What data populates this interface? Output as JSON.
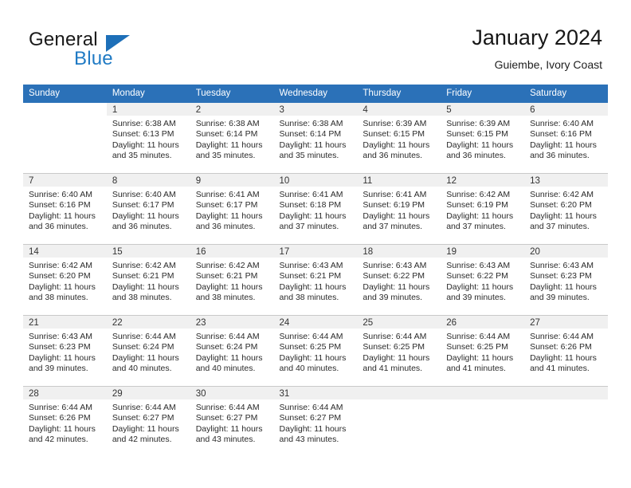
{
  "brand": {
    "name_part1": "General",
    "name_part2": "Blue",
    "flag_icon": "triangle-flag-icon"
  },
  "header": {
    "month_title": "January 2024",
    "location": "Guiembe, Ivory Coast"
  },
  "colors": {
    "header_blue": "#2b71b8",
    "brand_blue": "#1f7ac4",
    "daynum_strip": "#f0f0f0",
    "grid_line": "#c9c9c9"
  },
  "weekday_headers": [
    "Sunday",
    "Monday",
    "Tuesday",
    "Wednesday",
    "Thursday",
    "Friday",
    "Saturday"
  ],
  "labels": {
    "sunrise_prefix": "Sunrise:",
    "sunset_prefix": "Sunset:",
    "daylight_prefix": "Daylight:"
  },
  "weeks": [
    [
      {
        "day": "",
        "blank": true,
        "sunrise": "",
        "sunset": "",
        "daylight_line1": "",
        "daylight_line2": ""
      },
      {
        "day": "1",
        "sunrise": "Sunrise: 6:38 AM",
        "sunset": "Sunset: 6:13 PM",
        "daylight_line1": "Daylight: 11 hours",
        "daylight_line2": "and 35 minutes."
      },
      {
        "day": "2",
        "sunrise": "Sunrise: 6:38 AM",
        "sunset": "Sunset: 6:14 PM",
        "daylight_line1": "Daylight: 11 hours",
        "daylight_line2": "and 35 minutes."
      },
      {
        "day": "3",
        "sunrise": "Sunrise: 6:38 AM",
        "sunset": "Sunset: 6:14 PM",
        "daylight_line1": "Daylight: 11 hours",
        "daylight_line2": "and 35 minutes."
      },
      {
        "day": "4",
        "sunrise": "Sunrise: 6:39 AM",
        "sunset": "Sunset: 6:15 PM",
        "daylight_line1": "Daylight: 11 hours",
        "daylight_line2": "and 36 minutes."
      },
      {
        "day": "5",
        "sunrise": "Sunrise: 6:39 AM",
        "sunset": "Sunset: 6:15 PM",
        "daylight_line1": "Daylight: 11 hours",
        "daylight_line2": "and 36 minutes."
      },
      {
        "day": "6",
        "sunrise": "Sunrise: 6:40 AM",
        "sunset": "Sunset: 6:16 PM",
        "daylight_line1": "Daylight: 11 hours",
        "daylight_line2": "and 36 minutes."
      }
    ],
    [
      {
        "day": "7",
        "sunrise": "Sunrise: 6:40 AM",
        "sunset": "Sunset: 6:16 PM",
        "daylight_line1": "Daylight: 11 hours",
        "daylight_line2": "and 36 minutes."
      },
      {
        "day": "8",
        "sunrise": "Sunrise: 6:40 AM",
        "sunset": "Sunset: 6:17 PM",
        "daylight_line1": "Daylight: 11 hours",
        "daylight_line2": "and 36 minutes."
      },
      {
        "day": "9",
        "sunrise": "Sunrise: 6:41 AM",
        "sunset": "Sunset: 6:17 PM",
        "daylight_line1": "Daylight: 11 hours",
        "daylight_line2": "and 36 minutes."
      },
      {
        "day": "10",
        "sunrise": "Sunrise: 6:41 AM",
        "sunset": "Sunset: 6:18 PM",
        "daylight_line1": "Daylight: 11 hours",
        "daylight_line2": "and 37 minutes."
      },
      {
        "day": "11",
        "sunrise": "Sunrise: 6:41 AM",
        "sunset": "Sunset: 6:19 PM",
        "daylight_line1": "Daylight: 11 hours",
        "daylight_line2": "and 37 minutes."
      },
      {
        "day": "12",
        "sunrise": "Sunrise: 6:42 AM",
        "sunset": "Sunset: 6:19 PM",
        "daylight_line1": "Daylight: 11 hours",
        "daylight_line2": "and 37 minutes."
      },
      {
        "day": "13",
        "sunrise": "Sunrise: 6:42 AM",
        "sunset": "Sunset: 6:20 PM",
        "daylight_line1": "Daylight: 11 hours",
        "daylight_line2": "and 37 minutes."
      }
    ],
    [
      {
        "day": "14",
        "sunrise": "Sunrise: 6:42 AM",
        "sunset": "Sunset: 6:20 PM",
        "daylight_line1": "Daylight: 11 hours",
        "daylight_line2": "and 38 minutes."
      },
      {
        "day": "15",
        "sunrise": "Sunrise: 6:42 AM",
        "sunset": "Sunset: 6:21 PM",
        "daylight_line1": "Daylight: 11 hours",
        "daylight_line2": "and 38 minutes."
      },
      {
        "day": "16",
        "sunrise": "Sunrise: 6:42 AM",
        "sunset": "Sunset: 6:21 PM",
        "daylight_line1": "Daylight: 11 hours",
        "daylight_line2": "and 38 minutes."
      },
      {
        "day": "17",
        "sunrise": "Sunrise: 6:43 AM",
        "sunset": "Sunset: 6:21 PM",
        "daylight_line1": "Daylight: 11 hours",
        "daylight_line2": "and 38 minutes."
      },
      {
        "day": "18",
        "sunrise": "Sunrise: 6:43 AM",
        "sunset": "Sunset: 6:22 PM",
        "daylight_line1": "Daylight: 11 hours",
        "daylight_line2": "and 39 minutes."
      },
      {
        "day": "19",
        "sunrise": "Sunrise: 6:43 AM",
        "sunset": "Sunset: 6:22 PM",
        "daylight_line1": "Daylight: 11 hours",
        "daylight_line2": "and 39 minutes."
      },
      {
        "day": "20",
        "sunrise": "Sunrise: 6:43 AM",
        "sunset": "Sunset: 6:23 PM",
        "daylight_line1": "Daylight: 11 hours",
        "daylight_line2": "and 39 minutes."
      }
    ],
    [
      {
        "day": "21",
        "sunrise": "Sunrise: 6:43 AM",
        "sunset": "Sunset: 6:23 PM",
        "daylight_line1": "Daylight: 11 hours",
        "daylight_line2": "and 39 minutes."
      },
      {
        "day": "22",
        "sunrise": "Sunrise: 6:44 AM",
        "sunset": "Sunset: 6:24 PM",
        "daylight_line1": "Daylight: 11 hours",
        "daylight_line2": "and 40 minutes."
      },
      {
        "day": "23",
        "sunrise": "Sunrise: 6:44 AM",
        "sunset": "Sunset: 6:24 PM",
        "daylight_line1": "Daylight: 11 hours",
        "daylight_line2": "and 40 minutes."
      },
      {
        "day": "24",
        "sunrise": "Sunrise: 6:44 AM",
        "sunset": "Sunset: 6:25 PM",
        "daylight_line1": "Daylight: 11 hours",
        "daylight_line2": "and 40 minutes."
      },
      {
        "day": "25",
        "sunrise": "Sunrise: 6:44 AM",
        "sunset": "Sunset: 6:25 PM",
        "daylight_line1": "Daylight: 11 hours",
        "daylight_line2": "and 41 minutes."
      },
      {
        "day": "26",
        "sunrise": "Sunrise: 6:44 AM",
        "sunset": "Sunset: 6:25 PM",
        "daylight_line1": "Daylight: 11 hours",
        "daylight_line2": "and 41 minutes."
      },
      {
        "day": "27",
        "sunrise": "Sunrise: 6:44 AM",
        "sunset": "Sunset: 6:26 PM",
        "daylight_line1": "Daylight: 11 hours",
        "daylight_line2": "and 41 minutes."
      }
    ],
    [
      {
        "day": "28",
        "sunrise": "Sunrise: 6:44 AM",
        "sunset": "Sunset: 6:26 PM",
        "daylight_line1": "Daylight: 11 hours",
        "daylight_line2": "and 42 minutes."
      },
      {
        "day": "29",
        "sunrise": "Sunrise: 6:44 AM",
        "sunset": "Sunset: 6:27 PM",
        "daylight_line1": "Daylight: 11 hours",
        "daylight_line2": "and 42 minutes."
      },
      {
        "day": "30",
        "sunrise": "Sunrise: 6:44 AM",
        "sunset": "Sunset: 6:27 PM",
        "daylight_line1": "Daylight: 11 hours",
        "daylight_line2": "and 43 minutes."
      },
      {
        "day": "31",
        "sunrise": "Sunrise: 6:44 AM",
        "sunset": "Sunset: 6:27 PM",
        "daylight_line1": "Daylight: 11 hours",
        "daylight_line2": "and 43 minutes."
      },
      {
        "day": "",
        "blank": true,
        "sunrise": "",
        "sunset": "",
        "daylight_line1": "",
        "daylight_line2": ""
      },
      {
        "day": "",
        "blank": true,
        "sunrise": "",
        "sunset": "",
        "daylight_line1": "",
        "daylight_line2": ""
      },
      {
        "day": "",
        "blank": true,
        "sunrise": "",
        "sunset": "",
        "daylight_line1": "",
        "daylight_line2": ""
      }
    ]
  ]
}
